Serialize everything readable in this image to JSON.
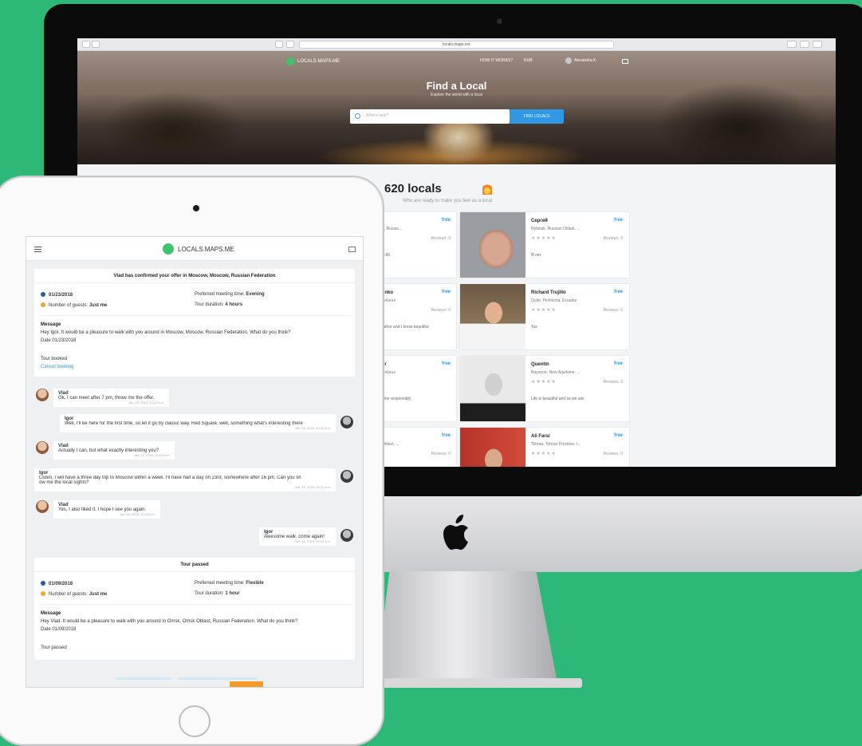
{
  "browser": {
    "url": "locals.maps.me"
  },
  "site": {
    "logo_text": "LOCALS.MAPS.ME",
    "nav": [
      "HOW IT WORKS?",
      "RUB"
    ],
    "user": "Alexandra K.",
    "hero_title": "Find a Local",
    "hero_subtitle": "Explore the world with a local",
    "search_placeholder": "Where next?",
    "find_button": "FIND LOCALS",
    "locals_count": "620 locals",
    "locals_sub": "Who are ready to make you feel as a local"
  },
  "cards_right": [
    {
      "name": "Сергей",
      "location": "Rybinsk, Russian Oblast, ...",
      "free": "free",
      "stars": "★★★★★",
      "reviews": "Reviews: 0",
      "about": "Я лет"
    },
    {
      "name": "Richard Trujillo",
      "location": "Quito, Pichincha, Ecuador",
      "free": "free",
      "stars": "★★★★★",
      "reviews": "Reviews: 0",
      "about": "Tos"
    },
    {
      "name": "Quentin",
      "location": "Bayonne, New Aquitaine, ...",
      "free": "free",
      "stars": "★★★★★",
      "reviews": "Reviews: 0",
      "about": "Life is beautiful and so we are."
    },
    {
      "name": "Ali Farsi",
      "location": "Tehran, Tehran Province, I...",
      "free": "free",
      "stars": "★★★★★",
      "reviews": "Reviews: 0",
      "about": ""
    }
  ],
  "cards_left": [
    {
      "name": "",
      "location": "e, Russia...",
      "free": "free",
      "reviews": "Reviews: 0",
      "about": "0-60"
    },
    {
      "name": "enko",
      "location": "Belarus",
      "free": "free",
      "reviews": "Reviews: 0",
      "about": "father and I know beautiful"
    },
    {
      "name": "er",
      "location": "Belarus",
      "free": "free",
      "reviews": "Reviews: 0",
      "about": "time responsibly"
    },
    {
      "name": "",
      "location": "Oblast, ...",
      "free": "free",
      "reviews": "Reviews: 0",
      "about": ""
    }
  ],
  "app": {
    "logo_text": "LOCALS.MAPS.ME",
    "offer_panel": {
      "header": "Vlad has confirmed your offer in Moscow, Moscow, Russian Federation",
      "date": "01/23/2018",
      "guests_label": "Number of guests:",
      "guests_value": "Just me",
      "meeting_label": "Preferred meeting time:",
      "meeting_value": "Evening",
      "duration_label": "Tour duration:",
      "duration_value": "4 hours",
      "message_title": "Message",
      "message_body": "Hey Igor. It would be a pleasure to walk with you around in Moscow, Moscow, Russian Federation. What do you think?",
      "message_date": "Date 01/23/2018",
      "status": "Tour booked",
      "cancel_link": "Cancel booking"
    },
    "chat": [
      {
        "name": "Vlad",
        "text": "Ok, I can meet after 7 pm, throw me the offer.",
        "date": "Jan. 15, 2018, 10:24 a.m."
      },
      {
        "name": "Igor",
        "text": "Well, I'll be here for the first time, so let it go by classic way. Red Square, well, something what's interesting there",
        "date": "Jan. 15, 2018, 10:23 a.m."
      },
      {
        "name": "Vlad",
        "text": "Actually I can, but what exactly interesting you?",
        "date": "Jan. 15, 2018, 10:22 a.m."
      },
      {
        "name": "Igor",
        "text": "Listen, I will have a three day trip to Moscow within a week. I'll have half a day on 23rd, somewhere after 16 pm. Can you sh",
        "text2": "ow me the local sights?",
        "date": "Jan. 15, 2018, 10:22 a.m."
      },
      {
        "name": "Vlad",
        "text": "Yes, I also liked it, I hope I see you again.",
        "date": "Jan. 15, 2018, 10:15 a.m."
      },
      {
        "name": "Igor",
        "text": "Awesome walk, come again!",
        "date": "Jan. 15, 2018, 10:15 a.m."
      }
    ],
    "passed_panel": {
      "header": "Tour passed",
      "date": "01/09/2018",
      "guests_label": "Number of guests:",
      "guests_value": "Just me",
      "meeting_label": "Preferred meeting time:",
      "meeting_value": "Flexible",
      "duration_label": "Tour duration:",
      "duration_value": "1 hour",
      "message_title": "Message",
      "message_body": "Hey Vlad. It would be a pleasure to walk with you around in Omsk, Omsk Oblast, Russian Federation. What do you think?",
      "message_date": "Date 01/09/2018",
      "status": "Tour passed"
    }
  },
  "colors": {
    "background": "#2db877",
    "accent": "#3298e6",
    "logo": "#3ec46d"
  }
}
